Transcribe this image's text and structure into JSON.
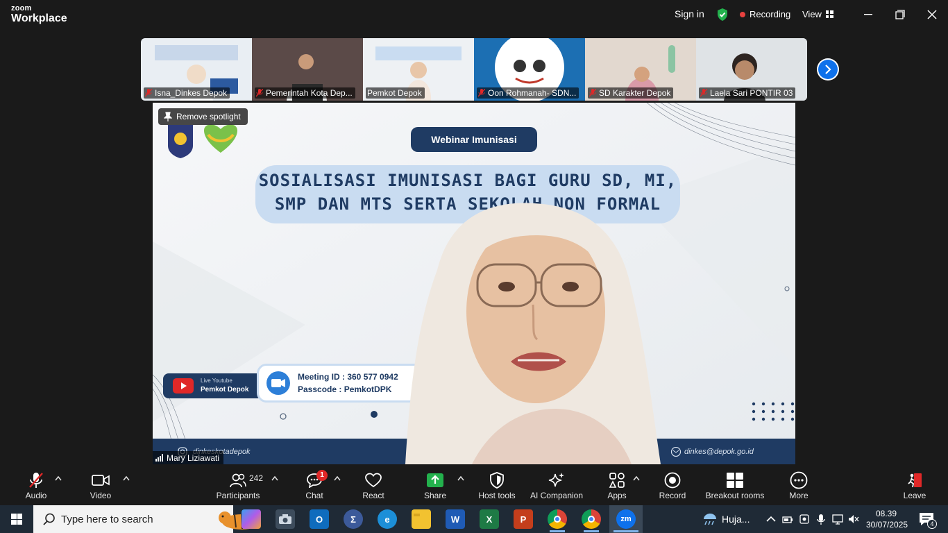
{
  "titlebar": {
    "brand_line1": "zoom",
    "brand_line2": "Workplace",
    "sign_in": "Sign in",
    "recording": "Recording",
    "view": "View"
  },
  "thumbnails": [
    {
      "name": "Isna_Dinkes Depok",
      "bg": "#e9eef3"
    },
    {
      "name": "Pemerintah Kota Dep...",
      "bg": "#6a5a55"
    },
    {
      "name": "Pemkot Depok",
      "bg": "#eef1f4"
    },
    {
      "name": "Oon Rohmanah- SDN...",
      "bg": "#f4f4f4"
    },
    {
      "name": "SD Karakter Depok",
      "bg": "#d8cfc7"
    },
    {
      "name": "Laela Sari PONTIR 03",
      "bg": "#e5e8ea"
    }
  ],
  "video": {
    "remove_spotlight": "Remove spotlight",
    "webinar_pill": "Webinar Imunisasi",
    "banner_line1": "SOSIALISASI IMUNISASI BAGI GURU SD, MI,",
    "banner_line2": "SMP DAN MTS SERTA SEKOLAH NON FORMAL",
    "meeting_id": "Meeting ID : 360 577 0942",
    "passcode": "Passcode   : PemkotDPK",
    "yt_line1": "Live Youtube",
    "yt_line2": "Pemkot Depok",
    "footer_ig": "dinkeskotadepok",
    "footer_mail": "dinkes@depok.go.id",
    "speaker_name": "Mary Liziawati"
  },
  "toolbar": {
    "audio": "Audio",
    "video": "Video",
    "participants": "Participants",
    "participants_count": "242",
    "chat": "Chat",
    "chat_badge": "1",
    "react": "React",
    "share": "Share",
    "host_tools": "Host tools",
    "ai_companion": "AI Companion",
    "apps": "Apps",
    "record": "Record",
    "breakout_rooms": "Breakout rooms",
    "more": "More",
    "leave": "Leave"
  },
  "taskbar": {
    "search_placeholder": "Type here to search",
    "weather": "Huja...",
    "time": "08.39",
    "date": "30/07/2025",
    "notification_count": "4"
  },
  "colors": {
    "zoom_blue": "#0e71eb",
    "share_green": "#23b14d",
    "rec_red": "#e8413f",
    "navy": "#1f3b63"
  }
}
